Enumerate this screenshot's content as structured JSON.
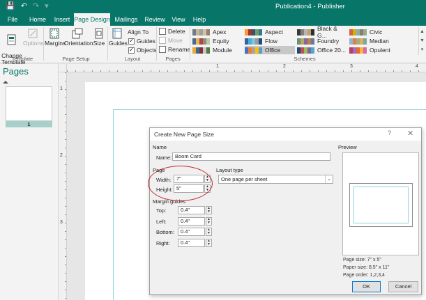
{
  "titlebar": {
    "title": "Publication4  -  Publisher"
  },
  "tabs": [
    "File",
    "Home",
    "Insert",
    "Page Design",
    "Mailings",
    "Review",
    "View",
    "Help"
  ],
  "ribbon": {
    "template": {
      "change_template": "Change\nTemplate",
      "options": "Options",
      "group": "Template"
    },
    "page_setup": {
      "margins": "Margins",
      "orientation": "Orientation",
      "size": "Size",
      "group": "Page Setup"
    },
    "layout": {
      "guides": "Guides",
      "align_to": "Align To",
      "guides_check": "Guides",
      "objects_check": "Objects",
      "group": "Layout"
    },
    "pages": {
      "delete": "Delete",
      "move": "Move",
      "rename": "Rename",
      "group": "Pages"
    },
    "schemes": {
      "group": "Schemes",
      "items": [
        {
          "name": "Apex",
          "colors": [
            "#6f7b8b",
            "#c5b68b",
            "#a0a0a0",
            "#cfc3a6",
            "#98806e"
          ]
        },
        {
          "name": "Equity",
          "colors": [
            "#4c6b88",
            "#e2b659",
            "#a94b3c",
            "#8f8d83",
            "#c2c6a6"
          ]
        },
        {
          "name": "Module",
          "colors": [
            "#e8a936",
            "#3a6c8e",
            "#8a2f2f",
            "#c6c6c6",
            "#4f7b3c"
          ]
        },
        {
          "name": "Aspect",
          "colors": [
            "#f29b37",
            "#a0362c",
            "#3b4f7a",
            "#6fa15b",
            "#2c7b9a"
          ]
        },
        {
          "name": "Flow",
          "colors": [
            "#3d5f9f",
            "#49b0d7",
            "#7ac8d9",
            "#9b9b9b",
            "#1f4e79"
          ]
        },
        {
          "name": "Office",
          "colors": [
            "#4472c4",
            "#ed7d31",
            "#a5a5a5",
            "#ffc000",
            "#5b9bd5"
          ]
        },
        {
          "name": "Black & G...",
          "colors": [
            "#3a3a3a",
            "#7f7f7f",
            "#b5b5b5",
            "#c0a06b",
            "#2f2f2f"
          ]
        },
        {
          "name": "Foundry",
          "colors": [
            "#6f8f72",
            "#b4a86b",
            "#7e6a9b",
            "#c47b4b",
            "#5d7f9b"
          ]
        },
        {
          "name": "Office 20...",
          "colors": [
            "#1f497d",
            "#c0504d",
            "#9bbb59",
            "#8064a2",
            "#4bacc6"
          ]
        },
        {
          "name": "Civic",
          "colors": [
            "#d16349",
            "#ccb400",
            "#8cadae",
            "#8c7b70",
            "#8fb08c"
          ]
        },
        {
          "name": "Median",
          "colors": [
            "#94b6d2",
            "#dd8047",
            "#a5ab81",
            "#d8b25c",
            "#7ba79d"
          ]
        },
        {
          "name": "Opulent",
          "colors": [
            "#b83d68",
            "#ac66bb",
            "#de6c36",
            "#f9b639",
            "#cf6da4"
          ]
        }
      ],
      "selected": "Office"
    }
  },
  "pages_pane": {
    "title": "Pages",
    "thumb_number": "1"
  },
  "rulers": {
    "h": [
      "1",
      "2",
      "3",
      "4"
    ],
    "v": [
      "1",
      "2",
      "3"
    ]
  },
  "dialog": {
    "title": "Create New Page Size",
    "help": "?",
    "name_section": "Name",
    "name_label": "Name:",
    "name_value": "Boom Card",
    "page_section": "Page",
    "width_label": "Width:",
    "width_value": "7\"",
    "height_label": "Height:",
    "height_value": "5\"",
    "layout_type_label": "Layout type",
    "layout_type_value": "One page per sheet",
    "margin_section": "Margin guides",
    "top_label": "Top:",
    "top_value": "0.4\"",
    "left_label": "Left:",
    "left_value": "0.4\"",
    "bottom_label": "Bottom:",
    "bottom_value": "0.4\"",
    "right_label": "Right:",
    "right_value": "0.4\"",
    "preview_label": "Preview",
    "page_size": "Page size: 7\" x 5\"",
    "paper_size": "Paper size: 8.5\" x 11\"",
    "page_order": "Page order: 1,2,3,4",
    "ok": "OK",
    "cancel": "Cancel"
  },
  "colors": {
    "accent": "#077568",
    "callout": "#c0262d",
    "guide": "#8fd3dc"
  }
}
